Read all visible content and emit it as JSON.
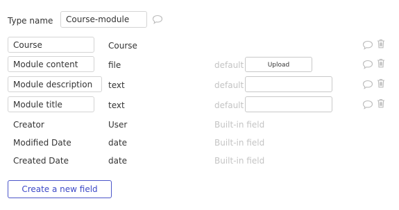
{
  "header": {
    "type_name_label": "Type name",
    "type_name_value": "Course-module"
  },
  "fields": [
    {
      "name": "Course",
      "type": "Course",
      "default_label": "",
      "default_control": "none",
      "built_in": ""
    },
    {
      "name": "Module content",
      "type": "file",
      "default_label": "default",
      "default_control": "upload",
      "upload_label": "Upload",
      "built_in": ""
    },
    {
      "name": "Module description",
      "type": "text",
      "default_label": "default",
      "default_control": "input",
      "built_in": ""
    },
    {
      "name": "Module title",
      "type": "text",
      "default_label": "default",
      "default_control": "input",
      "built_in": ""
    },
    {
      "name": "Creator",
      "type": "User",
      "built_in": "Built-in field"
    },
    {
      "name": "Modified Date",
      "type": "date",
      "built_in": "Built-in field"
    },
    {
      "name": "Created Date",
      "type": "date",
      "built_in": "Built-in field"
    }
  ],
  "actions": {
    "create_field_label": "Create a new field"
  },
  "icons": {
    "comment": "comment-icon",
    "trash": "trash-icon"
  },
  "colors": {
    "accent": "#3d49c7",
    "border": "#d4d4d4",
    "muted": "#c4c4c4",
    "icon": "#bcbcbc"
  }
}
